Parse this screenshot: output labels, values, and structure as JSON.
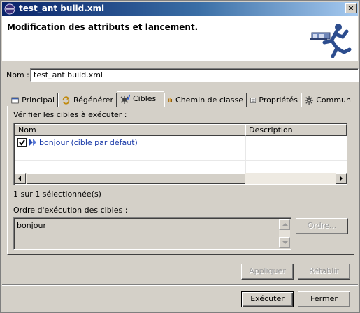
{
  "window": {
    "title": "test_ant build.xml"
  },
  "header": {
    "heading": "Modification des attributs et lancement."
  },
  "name_field": {
    "label": "Nom :",
    "value": "test_ant build.xml"
  },
  "tabs": [
    {
      "label": "Principal",
      "icon": "main-tab-icon"
    },
    {
      "label": "Régénérer",
      "icon": "refresh-icon"
    },
    {
      "label": "Cibles",
      "icon": "targets-icon",
      "active": true
    },
    {
      "label": "Chemin de classe",
      "icon": "classpath-icon"
    },
    {
      "label": "Propriétés",
      "icon": "properties-icon"
    },
    {
      "label": "Commun",
      "icon": "common-icon"
    }
  ],
  "targets": {
    "check_label": "Vérifier les cibles à exécuter :",
    "columns": [
      "Nom",
      "Description"
    ],
    "rows": [
      {
        "checked": true,
        "name": "bonjour (cible par défaut)",
        "description": ""
      }
    ],
    "selection_status": "1 sur 1 sélectionnée(s)"
  },
  "order": {
    "label": "Ordre d'exécution des cibles :",
    "items": [
      "bonjour"
    ],
    "button": "Ordre..."
  },
  "actions": {
    "apply": "Appliquer",
    "revert": "Rétablir"
  },
  "footer": {
    "run": "Exécuter",
    "close": "Fermer"
  },
  "colors": {
    "title_bar": "#0a246a",
    "link_text": "#1a3aa8",
    "dialog_bg": "#d4d0c8"
  }
}
